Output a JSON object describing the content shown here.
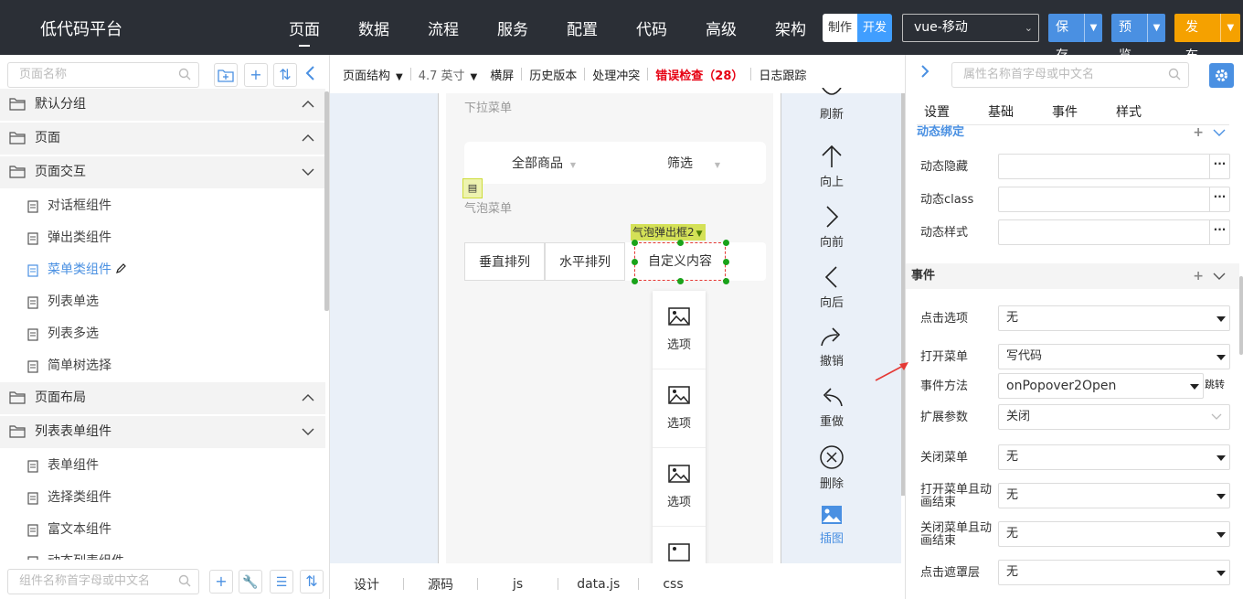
{
  "app": {
    "brand": "低代码平台",
    "nav": [
      "页面",
      "数据",
      "流程",
      "服务",
      "配置",
      "代码",
      "高级",
      "架构"
    ],
    "mode": {
      "make": "制作",
      "dev": "开发"
    },
    "framework": "vue-移动",
    "save": "保存",
    "preview": "预览",
    "publish": "发布"
  },
  "left": {
    "search_placeholder": "页面名称",
    "tree": [
      {
        "type": "group",
        "label": "默认分组",
        "expanded": true
      },
      {
        "type": "group",
        "label": "页面",
        "expanded": true
      },
      {
        "type": "group",
        "label": "页面交互",
        "expanded": false
      },
      {
        "type": "leaf",
        "label": "对话框组件"
      },
      {
        "type": "leaf",
        "label": "弹出类组件"
      },
      {
        "type": "leaf",
        "label": "菜单类组件",
        "active": true
      },
      {
        "type": "leaf",
        "label": "列表单选"
      },
      {
        "type": "leaf",
        "label": "列表多选"
      },
      {
        "type": "leaf",
        "label": "简单树选择"
      },
      {
        "type": "group",
        "label": "页面布局",
        "expanded": true
      },
      {
        "type": "group",
        "label": "列表表单组件",
        "expanded": false
      },
      {
        "type": "leaf",
        "label": "表单组件"
      },
      {
        "type": "leaf",
        "label": "选择类组件"
      },
      {
        "type": "leaf",
        "label": "富文本组件"
      },
      {
        "type": "leaf",
        "label": "动态列表组件"
      }
    ],
    "component_search_placeholder": "组件名称首字母或中文名"
  },
  "center": {
    "toolbar": {
      "structure": "页面结构",
      "size": "4.7 英寸",
      "landscape": "横屏",
      "history": "历史版本",
      "conflict": "处理冲突",
      "errors": "错误检查（28）",
      "log": "日志跟踪"
    },
    "canvas": {
      "dropdown_label": "下拉菜单",
      "dropdown_items": [
        "全部商品",
        "筛选"
      ],
      "bubble_label": "气泡菜单",
      "bubble_buttons": [
        "垂直排列",
        "水平排列",
        "自定义内容"
      ],
      "selected_tag": "气泡弹出框2",
      "popover_items": [
        "选项",
        "选项",
        "选项"
      ]
    },
    "tools": [
      "刷新",
      "向上",
      "向前",
      "向后",
      "撤销",
      "重做",
      "删除",
      "插图"
    ],
    "tabs": [
      "设计",
      "源码",
      "js",
      "data.js",
      "css"
    ]
  },
  "right": {
    "search_placeholder": "属性名称首字母或中文名",
    "tabs": [
      "设置",
      "基础",
      "事件",
      "样式"
    ],
    "dynamic": {
      "title": "动态绑定",
      "rows": [
        {
          "label": "动态隐藏",
          "value": ""
        },
        {
          "label": "动态class",
          "value": ""
        },
        {
          "label": "动态样式",
          "value": ""
        }
      ]
    },
    "events": {
      "title": "事件",
      "click_option": {
        "label": "点击选项",
        "value": "无"
      },
      "open_menu": {
        "label": "打开菜单",
        "value": "写代码"
      },
      "method": {
        "label": "事件方法",
        "value": "onPopover2Open",
        "jump": "跳转"
      },
      "extend": {
        "label": "扩展参数",
        "value": "关闭"
      },
      "close_menu": {
        "label": "关闭菜单",
        "value": "无"
      },
      "open_anim_end": {
        "label": "打开菜单且动画结束",
        "value": "无"
      },
      "close_anim_end": {
        "label": "关闭菜单且动画结束",
        "value": "无"
      },
      "click_mask": {
        "label": "点击遮罩层",
        "value": "无"
      }
    }
  },
  "colors": {
    "accent": "#4a90e2",
    "publish": "#f5a100",
    "error": "#e60012",
    "topbar": "#2b2f36"
  }
}
